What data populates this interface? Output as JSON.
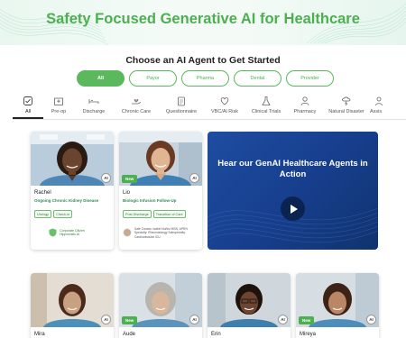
{
  "hero": {
    "title": "Safety Focused Generative AI for Healthcare"
  },
  "section_title": "Choose an AI Agent to Get Started",
  "filters": [
    {
      "label": "All",
      "active": true
    },
    {
      "label": "Payor",
      "active": false
    },
    {
      "label": "Pharma",
      "active": false
    },
    {
      "label": "Dental",
      "active": false
    },
    {
      "label": "Provider",
      "active": false
    }
  ],
  "categories": [
    {
      "label": "All",
      "icon": "checklist-icon",
      "active": true
    },
    {
      "label": "Pre-op",
      "icon": "hospital-icon",
      "active": false
    },
    {
      "label": "Discharge",
      "icon": "bed-icon",
      "active": false
    },
    {
      "label": "Chronic Care",
      "icon": "hand-heart-icon",
      "active": false
    },
    {
      "label": "Questionnaire",
      "icon": "clipboard-icon",
      "active": false
    },
    {
      "label": "VBC/Al Risk",
      "icon": "heart-pulse-icon",
      "active": false
    },
    {
      "label": "Clinical Trials",
      "icon": "flask-icon",
      "active": false
    },
    {
      "label": "Pharmacy",
      "icon": "pharmacist-icon",
      "active": false
    },
    {
      "label": "Natural Disaster",
      "icon": "storm-icon",
      "active": false
    },
    {
      "label": "Assis",
      "icon": "assistant-icon",
      "active": false
    }
  ],
  "cards": [
    {
      "name": "Rachel",
      "role": "Ongoing Chronic Kidney Disease",
      "tags": [
        "Urology",
        "Check-in"
      ],
      "is_new": false,
      "ai_badge": "AI",
      "sponsor": "Corporate Citizen Hippocratic AI"
    },
    {
      "name": "Lio",
      "role": "Biologic Infusion Follow-Up",
      "tags": [
        "Post Discharge",
        "Transition of Care"
      ],
      "is_new": true,
      "new_label": "New",
      "ai_badge": "AI",
      "creator": "Safe Creator: Isabel Nuñez MSN, APRN Specialty: Rheumatology Subspecialty: Cardiovascular ICU"
    }
  ],
  "video": {
    "title": "Hear our GenAI Healthcare Agents in Action"
  },
  "bottom_cards": [
    {
      "name": "Mira",
      "is_new": false,
      "new_label": "",
      "ai_badge": "AI"
    },
    {
      "name": "Aude",
      "is_new": true,
      "new_label": "New",
      "ai_badge": "AI"
    },
    {
      "name": "Erin",
      "is_new": false,
      "new_label": "",
      "ai_badge": "AI"
    },
    {
      "name": "Mireya",
      "is_new": true,
      "new_label": "New",
      "ai_badge": "AI"
    }
  ],
  "colors": {
    "brand_green": "#4caf50",
    "video_blue": "#1e4da1",
    "title_green": "#4caf50"
  }
}
